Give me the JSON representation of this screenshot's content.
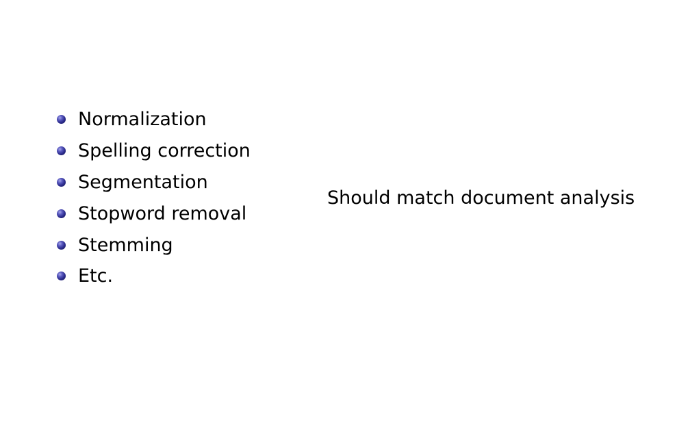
{
  "list": {
    "items": [
      {
        "label": "Normalization"
      },
      {
        "label": "Spelling correction"
      },
      {
        "label": "Segmentation"
      },
      {
        "label": "Stopword removal"
      },
      {
        "label": "Stemming"
      },
      {
        "label": "Etc."
      }
    ],
    "bullet_color": "#2a2a8a"
  },
  "note": {
    "text": "Should match document analysis"
  }
}
